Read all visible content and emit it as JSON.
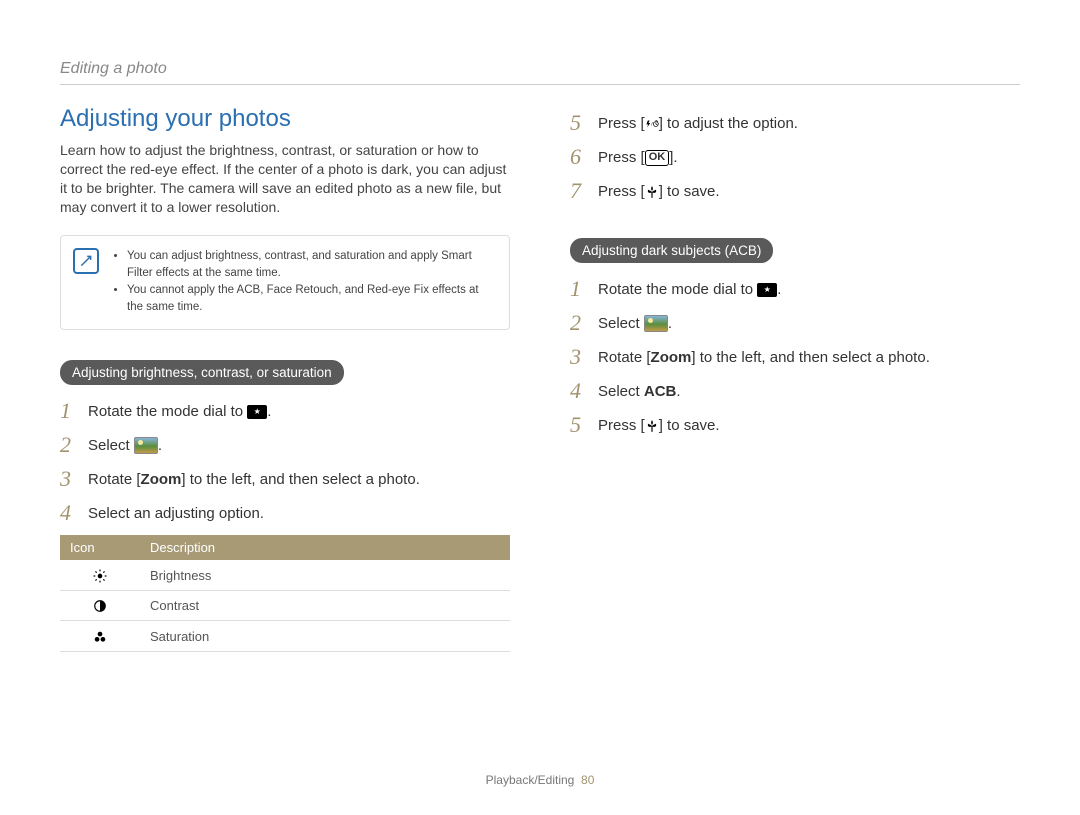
{
  "breadcrumb": "Editing a photo",
  "section_title": "Adjusting your photos",
  "intro": "Learn how to adjust the brightness, contrast, or saturation or how to correct the red-eye effect. If the center of a photo is dark, you can adjust it to be brighter. The camera will save an edited photo as a new file, but may convert it to a lower resolution.",
  "notes": [
    "You can adjust brightness, contrast, and saturation and apply Smart Filter effects at the same time.",
    "You cannot apply the ACB, Face Retouch, and Red-eye Fix effects at the same time."
  ],
  "pill1": "Adjusting brightness, contrast, or saturation",
  "steps_left": {
    "s1_a": "Rotate the mode dial to ",
    "s1_b": ".",
    "s2_a": "Select ",
    "s2_b": ".",
    "s3_a": "Rotate [",
    "s3_zoom": "Zoom",
    "s3_b": "] to the left, and then select a photo.",
    "s4": "Select an adjusting option."
  },
  "table": {
    "h_icon": "Icon",
    "h_desc": "Description",
    "r1": "Brightness",
    "r2": "Contrast",
    "r3": "Saturation"
  },
  "steps_right_top": {
    "s5_a": "Press [",
    "s5_b": "] to adjust the option.",
    "s6_a": "Press [",
    "s6_ok": "OK",
    "s6_b": "].",
    "s7_a": "Press [",
    "s7_b": "] to save."
  },
  "pill2": "Adjusting dark subjects (ACB)",
  "steps_acb": {
    "s1_a": "Rotate the mode dial to ",
    "s1_b": ".",
    "s2_a": "Select ",
    "s2_b": ".",
    "s3_a": "Rotate [",
    "s3_zoom": "Zoom",
    "s3_b": "] to the left, and then select a photo.",
    "s4_a": "Select ",
    "s4_acb": "ACB",
    "s4_b": ".",
    "s5_a": "Press [",
    "s5_b": "] to save."
  },
  "footer_section": "Playback/Editing",
  "footer_page": "80"
}
